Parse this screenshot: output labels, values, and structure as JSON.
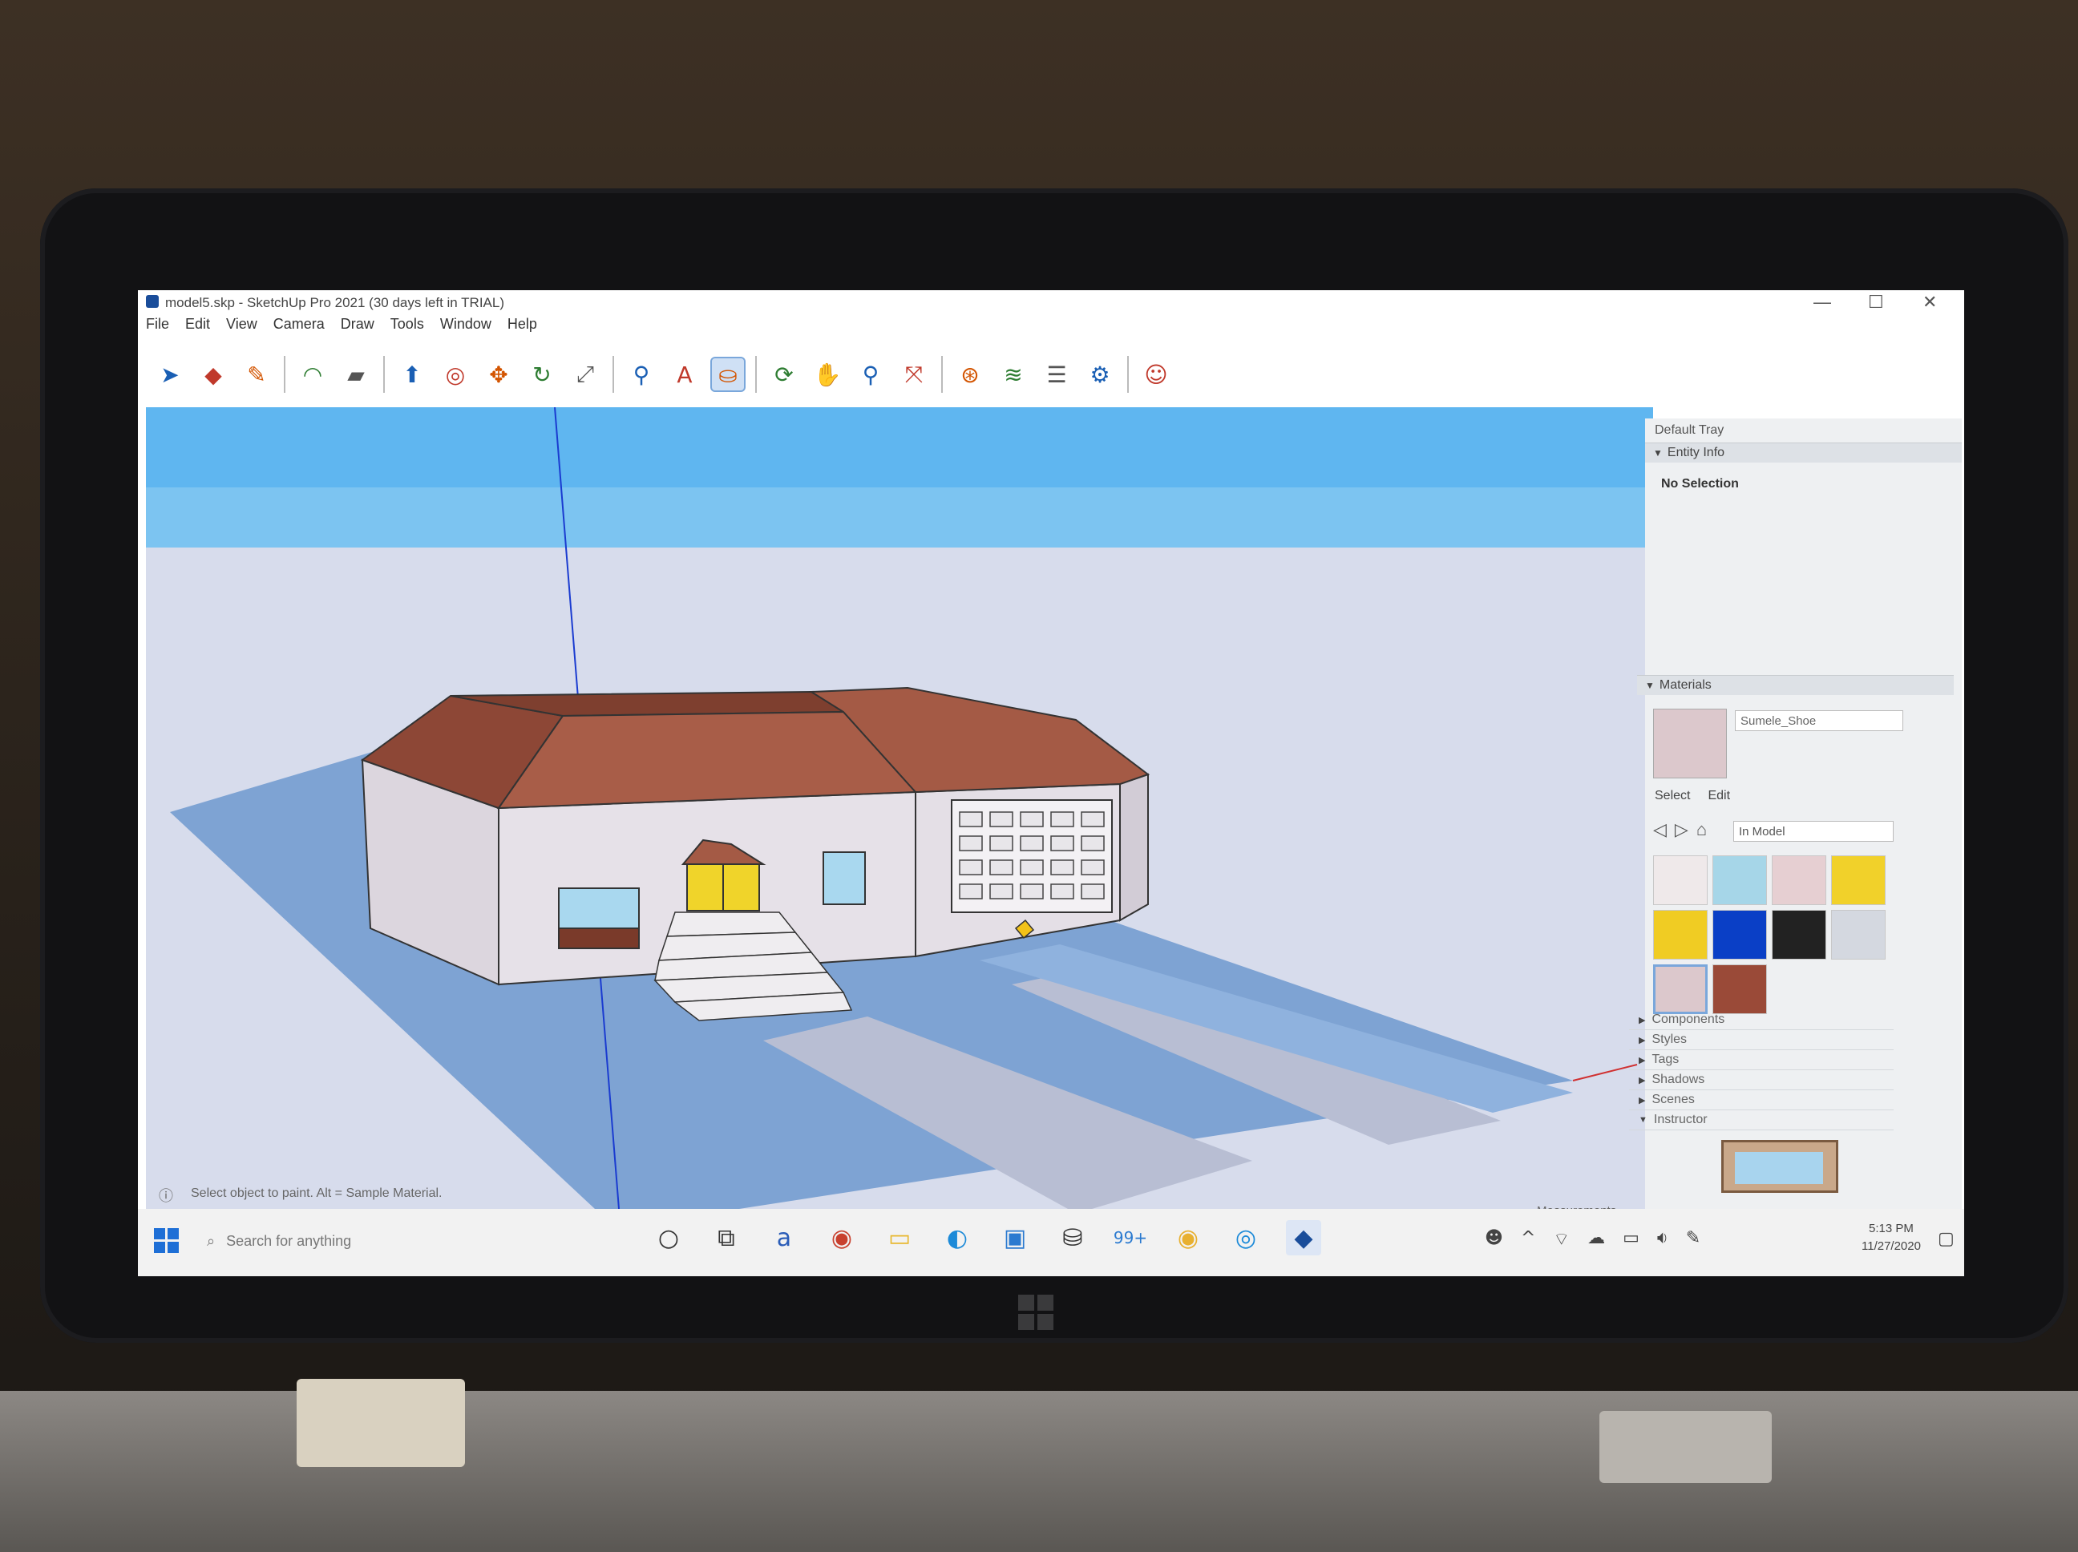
{
  "window": {
    "title": "model5.skp - SketchUp Pro 2021 (30 days left in TRIAL)",
    "controls": {
      "minimize": "—",
      "maximize": "☐",
      "close": "✕"
    }
  },
  "menu": {
    "items": [
      "File",
      "Edit",
      "View",
      "Camera",
      "Draw",
      "Tools",
      "Window",
      "Help"
    ]
  },
  "toolbar": {
    "tools": [
      {
        "name": "select-tool-icon",
        "glyph": "➤",
        "active": false
      },
      {
        "name": "eraser-tool-icon",
        "glyph": "◆",
        "active": false
      },
      {
        "name": "pencil-tool-icon",
        "glyph": "✎",
        "active": false
      },
      {
        "name": "arc-tool-icon",
        "glyph": "◠",
        "active": false
      },
      {
        "name": "rectangle-tool-icon",
        "glyph": "▰",
        "active": false
      },
      {
        "name": "push-pull-tool-icon",
        "glyph": "⬆",
        "active": false
      },
      {
        "name": "offset-tool-icon",
        "glyph": "◎",
        "active": false
      },
      {
        "name": "move-tool-icon",
        "glyph": "✥",
        "active": false
      },
      {
        "name": "rotate-tool-icon",
        "glyph": "↻",
        "active": false
      },
      {
        "name": "scale-tool-icon",
        "glyph": "⤢",
        "active": false
      },
      {
        "name": "tape-measure-tool-icon",
        "glyph": "⚲",
        "active": false
      },
      {
        "name": "text-tool-icon",
        "glyph": "A",
        "active": false
      },
      {
        "name": "paint-bucket-tool-icon",
        "glyph": "⛀",
        "active": true
      },
      {
        "name": "orbit-tool-icon",
        "glyph": "⟳",
        "active": false
      },
      {
        "name": "pan-tool-icon",
        "glyph": "✋",
        "active": false
      },
      {
        "name": "zoom-tool-icon",
        "glyph": "⚲",
        "active": false
      },
      {
        "name": "zoom-extents-tool-icon",
        "glyph": "⤧",
        "active": false
      },
      {
        "name": "warehouse-icon",
        "glyph": "⊛",
        "active": false
      },
      {
        "name": "extension-warehouse-icon",
        "glyph": "≋",
        "active": false
      },
      {
        "name": "layers-icon",
        "glyph": "☰",
        "active": false
      },
      {
        "name": "extension-manager-icon",
        "glyph": "⚙",
        "active": false
      },
      {
        "name": "account-icon",
        "glyph": "☺",
        "active": false
      }
    ]
  },
  "tray": {
    "title": "Default Tray",
    "entity_info": {
      "header": "Entity Info",
      "status": "No Selection"
    },
    "materials": {
      "header": "Materials",
      "current_name": "Sumele_Shoe",
      "tabs": [
        "Select",
        "Edit"
      ],
      "library": "In Model",
      "swatches": [
        {
          "color": "#efe9ea"
        },
        {
          "color": "#a6d6e8"
        },
        {
          "color": "#e6cfd2"
        },
        {
          "color": "#f1d12a"
        },
        {
          "color": "#f0cc23"
        },
        {
          "color": "#0a3fc6"
        },
        {
          "color": "#222222"
        },
        {
          "color": "#d4d8e0"
        },
        {
          "color": "#dcc8cc",
          "selected": true
        },
        {
          "color": "#9a4a38"
        }
      ]
    },
    "collapsed_panels": [
      "Components",
      "Styles",
      "Tags",
      "Shadows",
      "Scenes",
      "Instructor"
    ]
  },
  "status": {
    "hint": "Select object to paint. Alt = Sample Material.",
    "measurements_label": "Measurements"
  },
  "taskbar": {
    "search_placeholder": "Search for anything",
    "mail_badge": "99+",
    "time": "5:13 PM",
    "date": "11/27/2020"
  },
  "scene_colors": {
    "sky": "#5fb6f0",
    "ground": "#d7dcec",
    "lawn": "#7ea3d3",
    "roof": "#a45a45",
    "wall": "#e2dde4",
    "door": "#f0d42a",
    "window": "#a9d8ef"
  }
}
